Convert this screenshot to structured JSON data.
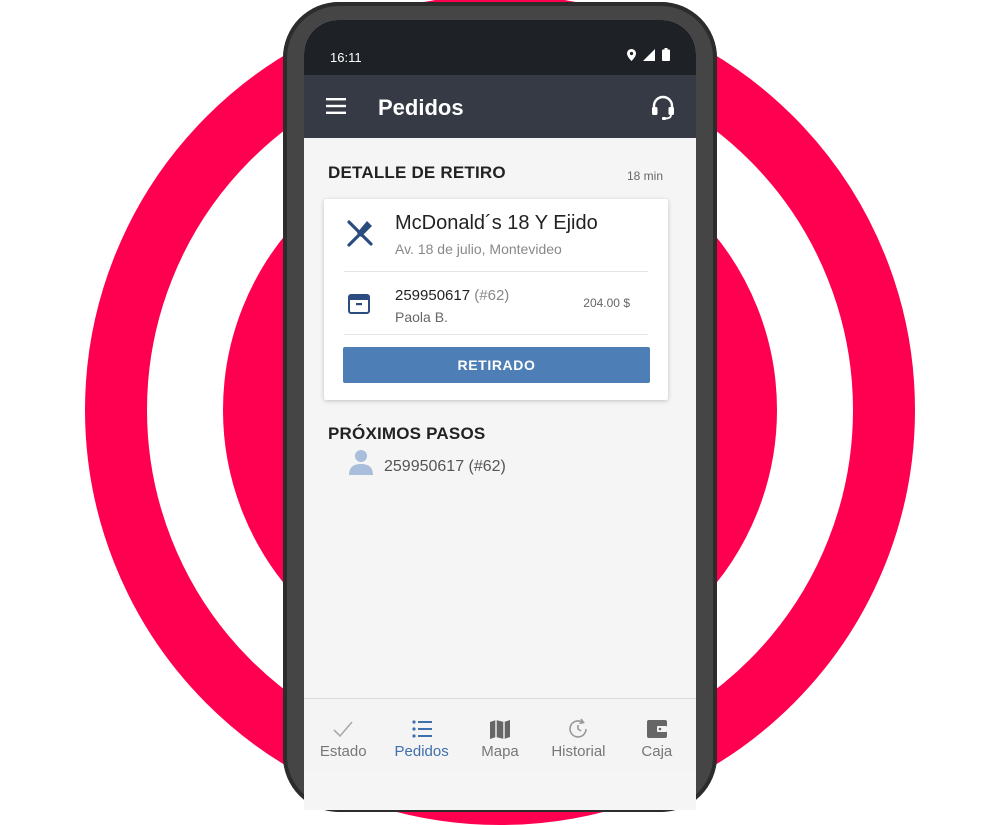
{
  "status_bar": {
    "time": "16:11"
  },
  "app_bar": {
    "title": "Pedidos"
  },
  "pickup": {
    "section_title": "DETALLE DE RETIRO",
    "eta": "18 min",
    "store_name": "McDonald´s 18 Y Ejido",
    "store_address": "Av. 18 de julio, Montevideo",
    "order_id": "259950617",
    "order_number": "(#62)",
    "client": "Paola B.",
    "amount": "204.00 $",
    "action_label": "RETIRADO"
  },
  "next_steps": {
    "section_title": "PRÓXIMOS PASOS",
    "items": [
      {
        "label": "259950617  (#62)"
      }
    ]
  },
  "bottom_nav": {
    "items": [
      {
        "label": "Estado"
      },
      {
        "label": "Pedidos"
      },
      {
        "label": "Mapa"
      },
      {
        "label": "Historial"
      },
      {
        "label": "Caja"
      }
    ],
    "active": "Pedidos"
  },
  "colors": {
    "background_ring": "#ff0050",
    "app_bar": "#353a44",
    "primary_button": "#4d7eb5",
    "active_nav": "#3f6fad"
  }
}
